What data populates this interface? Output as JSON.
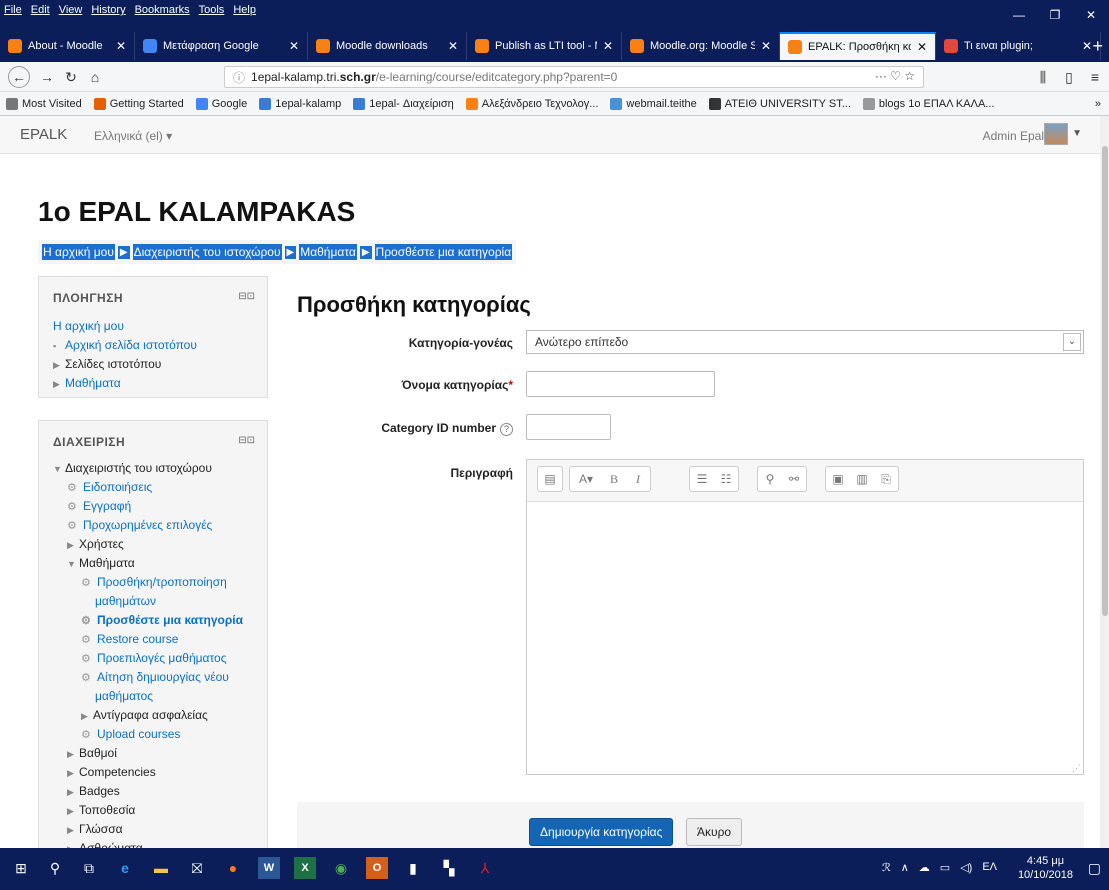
{
  "browser": {
    "menu": [
      "File",
      "Edit",
      "View",
      "History",
      "Bookmarks",
      "Tools",
      "Help"
    ],
    "tabs": [
      {
        "title": "About - Moodle",
        "color": "#f98012"
      },
      {
        "title": "Μετάφραση Google",
        "color": "#4285f4"
      },
      {
        "title": "Moodle downloads",
        "color": "#f98012"
      },
      {
        "title": "Publish as LTI tool - M",
        "color": "#f98012"
      },
      {
        "title": "Moodle.org: Moodle S",
        "color": "#f98012"
      },
      {
        "title": "EPALK: Προσθήκη κατ",
        "color": "#f98012"
      },
      {
        "title": "Τι ειναι plugin;",
        "color": "#e2473b"
      }
    ],
    "url_prefix": "1epal-kalamp.tri.",
    "url_host": "sch.gr",
    "url_tail": "/e-learning/course/editcategory.php?parent=0",
    "bookmarks": [
      {
        "label": "Most Visited",
        "color": "#777"
      },
      {
        "label": "Getting Started",
        "color": "#e66000"
      },
      {
        "label": "Google",
        "color": "#4285f4"
      },
      {
        "label": "1epal-kalamp",
        "color": "#3a7bd5"
      },
      {
        "label": "1epal- Διαχείριση",
        "color": "#3a7bd5"
      },
      {
        "label": "Αλεξάνδρειο Τεχνολογ...",
        "color": "#f98012"
      },
      {
        "label": "webmail.teithe",
        "color": "#4a90d9"
      },
      {
        "label": "ΑΤΕΙΘ UNIVERSITY ST...",
        "color": "#333"
      },
      {
        "label": "blogs 1ο ΕΠΑΛ ΚΑΛΑ...",
        "color": "#999"
      }
    ]
  },
  "moodle": {
    "brand": "EPALK",
    "language": "Ελληνικά (el) ▾",
    "user": "Admin Epal",
    "page_title": "1o EPAL KALAMPAKAS",
    "breadcrumb": [
      "Η αρχική μου",
      "Διαχειριστής του ιστοχώρου",
      "Μαθήματα",
      "Προσθέστε μια κατηγορία"
    ]
  },
  "nav_block": {
    "title": "ΠΛΟΗΓΗΣΗ",
    "items": [
      {
        "label": "Η αρχική μου",
        "type": "link",
        "icon": ""
      },
      {
        "label": "Αρχική σελίδα ιστοτόπου",
        "type": "link",
        "icon": "▪"
      },
      {
        "label": "Σελίδες ιστοτόπου",
        "type": "text",
        "icon": "▶"
      },
      {
        "label": "Μαθήματα",
        "type": "link",
        "icon": "▶"
      }
    ]
  },
  "admin_block": {
    "title": "ΔΙΑΧΕΙΡΙΣΗ",
    "items": [
      {
        "label": "Διαχειριστής του ιστοχώρου",
        "icon": "▼",
        "indent": 0,
        "type": "text"
      },
      {
        "label": "Ειδοποιήσεις",
        "icon": "gear",
        "indent": 1,
        "type": "link"
      },
      {
        "label": "Εγγραφή",
        "icon": "gear",
        "indent": 1,
        "type": "link"
      },
      {
        "label": "Προχωρημένες επιλογές",
        "icon": "gear",
        "indent": 1,
        "type": "link"
      },
      {
        "label": "Χρήστες",
        "icon": "▶",
        "indent": 1,
        "type": "text"
      },
      {
        "label": "Μαθήματα",
        "icon": "▼",
        "indent": 1,
        "type": "text"
      },
      {
        "label": "Προσθήκη/τροποποίηση",
        "icon": "gear",
        "indent": 2,
        "type": "link"
      },
      {
        "label": "μαθημάτων",
        "icon": "",
        "indent": 3,
        "type": "link"
      },
      {
        "label": "Προσθέστε μια κατηγορία",
        "icon": "gear",
        "indent": 2,
        "type": "link-bold"
      },
      {
        "label": "Restore course",
        "icon": "gear",
        "indent": 2,
        "type": "link"
      },
      {
        "label": "Προεπιλογές μαθήματος",
        "icon": "gear",
        "indent": 2,
        "type": "link"
      },
      {
        "label": "Αίτηση δημιουργίας νέου",
        "icon": "gear",
        "indent": 2,
        "type": "link"
      },
      {
        "label": "μαθήματος",
        "icon": "",
        "indent": 3,
        "type": "link"
      },
      {
        "label": "Αντίγραφα ασφαλείας",
        "icon": "▶",
        "indent": 2,
        "type": "text"
      },
      {
        "label": "Upload courses",
        "icon": "gear",
        "indent": 2,
        "type": "link"
      },
      {
        "label": "Βαθμοί",
        "icon": "▶",
        "indent": 1,
        "type": "text"
      },
      {
        "label": "Competencies",
        "icon": "▶",
        "indent": 1,
        "type": "text"
      },
      {
        "label": "Badges",
        "icon": "▶",
        "indent": 1,
        "type": "text"
      },
      {
        "label": "Τοποθεσία",
        "icon": "▶",
        "indent": 1,
        "type": "text"
      },
      {
        "label": "Γλώσσα",
        "icon": "▶",
        "indent": 1,
        "type": "text"
      },
      {
        "label": "Ασθρώματα",
        "icon": "▶",
        "indent": 1,
        "type": "text"
      }
    ]
  },
  "form": {
    "title": "Προσθήκη κατηγορίας",
    "parent_label": "Κατηγορία-γονέας",
    "parent_value": "Ανώτερο επίπεδο",
    "name_label": "Όνομα κατηγορίας",
    "idnumber_label": "Category ID number",
    "description_label": "Περιγραφή",
    "submit": "Δημιουργία κατηγορίας",
    "cancel": "Άκυρο"
  },
  "taskbar": {
    "time": "4:45 μμ",
    "date": "10/10/2018",
    "lang": "ΕΛ"
  }
}
